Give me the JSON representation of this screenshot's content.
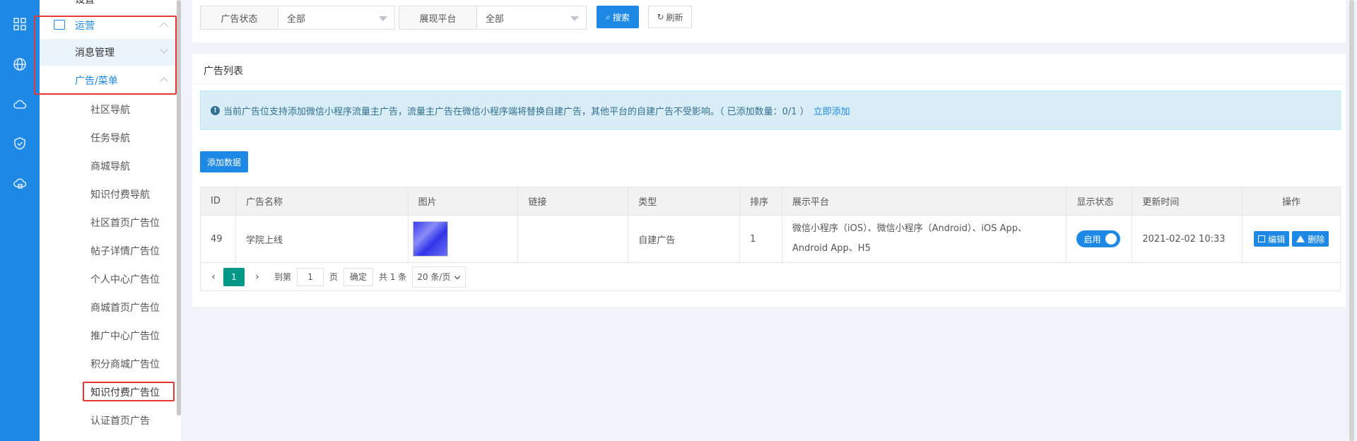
{
  "rail": {
    "icons": [
      "grid-icon",
      "globe-icon",
      "cloud-icon",
      "shield-check-icon",
      "cloud-lock-icon"
    ]
  },
  "sidebar": {
    "top_item": "设置",
    "group": {
      "label": "运营"
    },
    "msg_mgmt": {
      "label": "消息管理"
    },
    "ad_menu": {
      "label": "广告/菜单"
    },
    "sub_items": [
      "社区导航",
      "任务导航",
      "商城导航",
      "知识付费导航",
      "社区首页广告位",
      "帖子详情广告位",
      "个人中心广告位",
      "商城首页广告位",
      "推广中心广告位",
      "积分商城广告位",
      "知识付费广告位",
      "认证首页广告"
    ]
  },
  "filters": {
    "status": {
      "label": "广告状态",
      "value": "全部"
    },
    "platform": {
      "label": "展现平台",
      "value": "全部"
    },
    "search_label": "搜索",
    "refresh_label": "刷新"
  },
  "list": {
    "title": "广告列表",
    "notice_text": "当前广告位支持添加微信小程序流量主广告，流量主广告在微信小程序端将替换自建广告，其他平台的自建广告不受影响。（ 已添加数量：0/1 ）",
    "notice_link": "立即添加",
    "add_button": "添加数据",
    "columns": [
      "ID",
      "广告名称",
      "图片",
      "链接",
      "类型",
      "排序",
      "展示平台",
      "显示状态",
      "更新时间",
      "操作"
    ],
    "rows": [
      {
        "id": "49",
        "name": "学院上线",
        "link": "",
        "type": "自建广告",
        "sort": "1",
        "platform_line1": "微信小程序（iOS）、微信小程序（Android）、iOS App、",
        "platform_line2": "Android App、H5",
        "status": "启用",
        "updated": "2021-02-02 10:33",
        "edit": "编辑",
        "delete": "删除"
      }
    ]
  },
  "pager": {
    "current": "1",
    "goto": "到第",
    "page_value": "1",
    "page_unit": "页",
    "confirm": "确定",
    "total": "共 1 条",
    "page_size": "20 条/页"
  },
  "colors": {
    "primary": "#1e88e5",
    "pager_active": "#009688",
    "highlight": "#e53935"
  }
}
